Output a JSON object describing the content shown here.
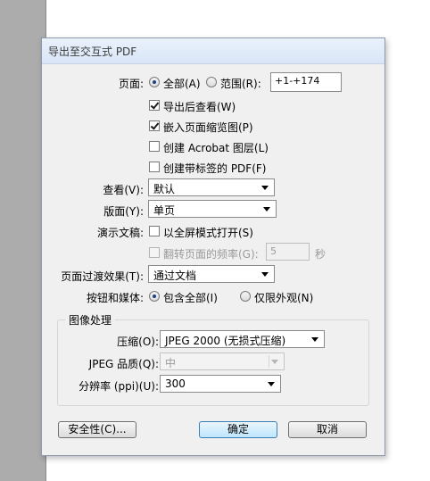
{
  "dialog": {
    "title": "导出至交互式 PDF"
  },
  "pages": {
    "label": "页面:",
    "all_label": "全部(A)",
    "range_label": "范围(R):",
    "range_value": "+1-+174",
    "selected": "all"
  },
  "checkboxes": [
    {
      "label": "导出后查看(W)",
      "checked": true,
      "disabled": false
    },
    {
      "label": "嵌入页面缩览图(P)",
      "checked": true,
      "disabled": false
    },
    {
      "label": "创建 Acrobat 图层(L)",
      "checked": false,
      "disabled": false
    },
    {
      "label": "创建带标签的 PDF(F)",
      "checked": false,
      "disabled": false
    }
  ],
  "view": {
    "label": "查看(V):",
    "value": "默认"
  },
  "layout": {
    "label": "版面(Y):",
    "value": "单页"
  },
  "presentation": {
    "label": "演示文稿:",
    "fullscreen_label": "以全屏模式打开(S)",
    "fullscreen_checked": false,
    "flip_label": "翻转页面的频率(G):",
    "flip_value": "5",
    "flip_unit": "秒",
    "flip_disabled": true
  },
  "transitions": {
    "label": "页面过渡效果(T):",
    "value": "通过文档"
  },
  "buttons_media": {
    "label": "按钮和媒体:",
    "include_all_label": "包含全部(I)",
    "appearance_only_label": "仅限外观(N)",
    "selected": "include_all"
  },
  "image_handling": {
    "title": "图像处理",
    "compression_label": "压缩(O):",
    "compression_value": "JPEG 2000 (无损式压缩)",
    "quality_label": "JPEG 品质(Q):",
    "quality_value": "中",
    "quality_disabled": true,
    "resolution_label": "分辨率 (ppi)(U):",
    "resolution_value": "300"
  },
  "footer": {
    "security_label": "安全性(C)...",
    "ok_label": "确定",
    "cancel_label": "取消"
  }
}
